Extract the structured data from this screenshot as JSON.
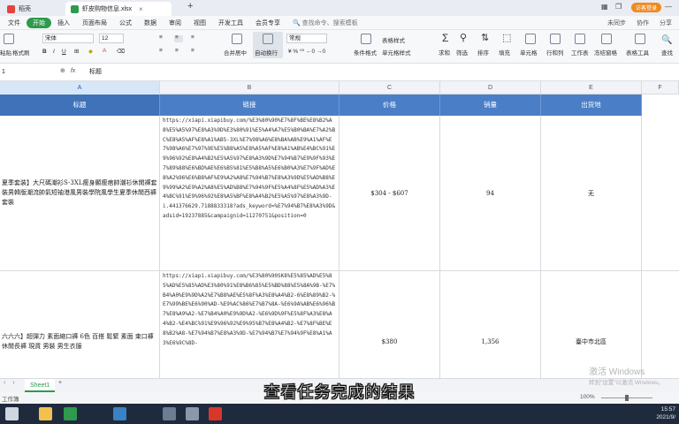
{
  "tabs": [
    {
      "label": "稻壳",
      "icon_color": "#e5433d",
      "active": false
    },
    {
      "label": "虾皮购物信息.xlsx",
      "icon_color": "#2e9a4f",
      "active": true
    }
  ],
  "add_tab": "+",
  "login_label": "访客登录",
  "menu": [
    "文件",
    "开始",
    "插入",
    "页面布局",
    "公式",
    "数据",
    "审阅",
    "视图",
    "开发工具",
    "会员专享",
    "查找命令、搜索模板"
  ],
  "menu_right": [
    "未同步",
    "协作",
    "分享"
  ],
  "ribbon": {
    "paste": "粘贴",
    "format_painter": "格式刷",
    "font_name": "宋体",
    "font_size": "12",
    "number_format": "常规",
    "merge": "合并居中",
    "wrap": "自动换行",
    "cond_format": "条件格式",
    "table_style": "表格样式",
    "cell_style": "单元格样式",
    "sum": "求和",
    "filter": "筛选",
    "sort": "排序",
    "fill": "填充",
    "cells": "单元格",
    "rowcol": "行和列",
    "sheet": "工作表",
    "freeze": "冻结窗格",
    "tools": "表格工具",
    "find": "查找"
  },
  "formula_bar": {
    "cell_ref": "1",
    "fx": "fx",
    "content": "标题"
  },
  "columns": [
    "A",
    "B",
    "C",
    "D",
    "E",
    "F"
  ],
  "headers": [
    "标题",
    "链接",
    "价格",
    "销量",
    "出货地",
    ""
  ],
  "rows": [
    {
      "title": "夏季套装】大尺碼潮衫S-3XL瘦身顯瘦痞帥潮衫休閒褲套裝男韓版潮流帥氣短袖港風男裝學院風學生夏季休閒西褲套裝",
      "link": "https://xiapi.xiapibuy.com/%E3%80%90%E7%8F%BE%E8%B2%A8%E5%A5%97%E8%A3%9D%E3%80%91%E5%A4%A7%E5%B0%BA%E7%A2%BC%E8%A5%AF%E8%A1%ABS-3XL%E7%98%A6%E8%BA%AB%E9%A1%AF%E7%98%A6%E7%97%9E%E5%B8%A5%E8%A5%AF%E8%A1%AB%E4%BC%91%E9%96%92%E8%A4%B2%E5%A5%97%E8%A3%9D%E7%94%B7%E9%9F%93%E7%89%88%E6%BD%AE%E6%B5%81%E5%B8%A5%E6%B0%A3%E7%9F%AD%E8%A2%96%E6%B8%AF%E9%A2%A8%E7%94%B7%E8%A3%9D%E5%AD%B8%E9%99%A2%E9%A2%A8%E5%AD%B8%E7%94%9F%E5%A4%8F%E5%AD%A3%E4%BC%91%E9%96%92%E8%A5%BF%E8%A4%B2%E5%A5%97%E8%A3%9D-i.441376629.7188833318?ads_keyword=%E7%94%B7%E8%A3%9D&adsid=19237885&campaignid=11270751&position=0",
      "price": "$304 - $607",
      "sales": "94",
      "origin": "无"
    },
    {
      "title": "六六六】超彈力 素面縮口褲 6色 百搭 鬆緊 素面 束口褲 休閒長褲 現貨 男裝 男生衣服",
      "link": "https://xiapi.xiapibuy.com/%E3%80%90SK8%E5%85%AD%E5%85%AD%E5%85%AD%E3%80%91%E8%B6%85%E5%BD%88%E5%8A%9B-%E7%B4%A0%E9%9D%A2%E7%B8%AE%E5%8F%A3%E8%A4%B2-6%E8%89%B2-%E7%99%BE%E6%90%AD-%E9%AC%86%E7%B7%8A-%E6%9A%AB%E6%96%B7%E8%A9%A2-%E7%B4%A0%E9%9D%A2-%E6%9D%9F%E5%8F%A3%E8%A4%B2-%E4%BC%91%E9%96%92%E9%95%B7%E8%A4%B2-%E7%8F%BE%E8%B2%A8-%E7%94%B7%E8%A3%9D-%E7%94%B7%E7%94%9F%E8%A1%A3%E6%9C%8D-",
      "price": "$380",
      "sales": "1,356",
      "origin": "臺中市北區"
    }
  ],
  "sheet_tab": "Sheet1",
  "sheet_add": "+",
  "status_left": "工作簿",
  "zoom": "100%",
  "subtitle": "查看任务完成的结果",
  "watermark": {
    "title": "激活 Windows",
    "sub": "转到\"设置\"以激活 Windows。"
  },
  "clock": {
    "time": "15:57",
    "date": "2021/9/"
  },
  "taskbar_icons": [
    {
      "name": "start",
      "color": "#cfd6e0"
    },
    {
      "name": "explorer",
      "color": "#f2c14e"
    },
    {
      "name": "excel-green",
      "color": "#2e9a4f"
    },
    {
      "name": "browser",
      "color": "#3b82c4"
    },
    {
      "name": "app",
      "color": "#6b7c93"
    },
    {
      "name": "app2",
      "color": "#8a98ab"
    },
    {
      "name": "wps",
      "color": "#d9362b"
    }
  ]
}
